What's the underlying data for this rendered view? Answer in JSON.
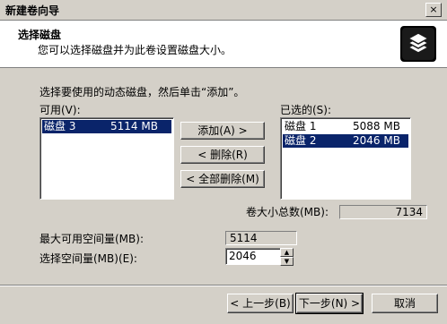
{
  "window": {
    "title": "新建卷向导",
    "close_glyph": "×"
  },
  "header": {
    "title": "选择磁盘",
    "subtitle": "您可以选择磁盘并为此卷设置磁盘大小。",
    "icon": "disk-stack-icon"
  },
  "instruction": "选择要使用的动态磁盘，然后单击“添加”。",
  "available": {
    "label": "可用(V):",
    "items": [
      {
        "name": "磁盘 3",
        "size": "5114 MB",
        "selected": true
      }
    ]
  },
  "selected_list": {
    "label": "已选的(S):",
    "items": [
      {
        "name": "磁盘 1",
        "size": "5088 MB",
        "selected": false
      },
      {
        "name": "磁盘 2",
        "size": "2046 MB",
        "selected": true
      }
    ]
  },
  "buttons": {
    "add": "添加(A) >",
    "remove": "< 删除(R)",
    "remove_all": "< 全部删除(M)"
  },
  "total": {
    "label": "卷大小总数(MB):",
    "value": "7134"
  },
  "max_space": {
    "label": "最大可用空间量(MB):",
    "value": "5114"
  },
  "select_space": {
    "label": "选择空间量(MB)(E):",
    "value": "2046"
  },
  "nav": {
    "back": "< 上一步(B)",
    "next": "下一步(N) >",
    "cancel": "取消"
  }
}
